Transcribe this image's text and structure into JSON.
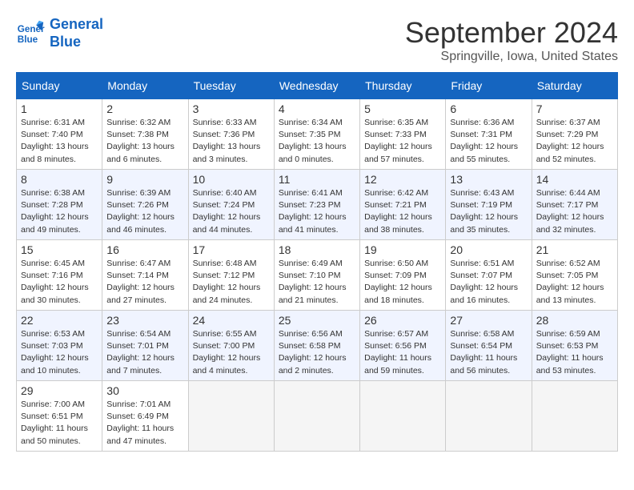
{
  "header": {
    "logo_line1": "General",
    "logo_line2": "Blue",
    "month": "September 2024",
    "location": "Springville, Iowa, United States"
  },
  "weekdays": [
    "Sunday",
    "Monday",
    "Tuesday",
    "Wednesday",
    "Thursday",
    "Friday",
    "Saturday"
  ],
  "weeks": [
    [
      {
        "day": "1",
        "sunrise": "Sunrise: 6:31 AM",
        "sunset": "Sunset: 7:40 PM",
        "daylight": "Daylight: 13 hours and 8 minutes."
      },
      {
        "day": "2",
        "sunrise": "Sunrise: 6:32 AM",
        "sunset": "Sunset: 7:38 PM",
        "daylight": "Daylight: 13 hours and 6 minutes."
      },
      {
        "day": "3",
        "sunrise": "Sunrise: 6:33 AM",
        "sunset": "Sunset: 7:36 PM",
        "daylight": "Daylight: 13 hours and 3 minutes."
      },
      {
        "day": "4",
        "sunrise": "Sunrise: 6:34 AM",
        "sunset": "Sunset: 7:35 PM",
        "daylight": "Daylight: 13 hours and 0 minutes."
      },
      {
        "day": "5",
        "sunrise": "Sunrise: 6:35 AM",
        "sunset": "Sunset: 7:33 PM",
        "daylight": "Daylight: 12 hours and 57 minutes."
      },
      {
        "day": "6",
        "sunrise": "Sunrise: 6:36 AM",
        "sunset": "Sunset: 7:31 PM",
        "daylight": "Daylight: 12 hours and 55 minutes."
      },
      {
        "day": "7",
        "sunrise": "Sunrise: 6:37 AM",
        "sunset": "Sunset: 7:29 PM",
        "daylight": "Daylight: 12 hours and 52 minutes."
      }
    ],
    [
      {
        "day": "8",
        "sunrise": "Sunrise: 6:38 AM",
        "sunset": "Sunset: 7:28 PM",
        "daylight": "Daylight: 12 hours and 49 minutes."
      },
      {
        "day": "9",
        "sunrise": "Sunrise: 6:39 AM",
        "sunset": "Sunset: 7:26 PM",
        "daylight": "Daylight: 12 hours and 46 minutes."
      },
      {
        "day": "10",
        "sunrise": "Sunrise: 6:40 AM",
        "sunset": "Sunset: 7:24 PM",
        "daylight": "Daylight: 12 hours and 44 minutes."
      },
      {
        "day": "11",
        "sunrise": "Sunrise: 6:41 AM",
        "sunset": "Sunset: 7:23 PM",
        "daylight": "Daylight: 12 hours and 41 minutes."
      },
      {
        "day": "12",
        "sunrise": "Sunrise: 6:42 AM",
        "sunset": "Sunset: 7:21 PM",
        "daylight": "Daylight: 12 hours and 38 minutes."
      },
      {
        "day": "13",
        "sunrise": "Sunrise: 6:43 AM",
        "sunset": "Sunset: 7:19 PM",
        "daylight": "Daylight: 12 hours and 35 minutes."
      },
      {
        "day": "14",
        "sunrise": "Sunrise: 6:44 AM",
        "sunset": "Sunset: 7:17 PM",
        "daylight": "Daylight: 12 hours and 32 minutes."
      }
    ],
    [
      {
        "day": "15",
        "sunrise": "Sunrise: 6:45 AM",
        "sunset": "Sunset: 7:16 PM",
        "daylight": "Daylight: 12 hours and 30 minutes."
      },
      {
        "day": "16",
        "sunrise": "Sunrise: 6:47 AM",
        "sunset": "Sunset: 7:14 PM",
        "daylight": "Daylight: 12 hours and 27 minutes."
      },
      {
        "day": "17",
        "sunrise": "Sunrise: 6:48 AM",
        "sunset": "Sunset: 7:12 PM",
        "daylight": "Daylight: 12 hours and 24 minutes."
      },
      {
        "day": "18",
        "sunrise": "Sunrise: 6:49 AM",
        "sunset": "Sunset: 7:10 PM",
        "daylight": "Daylight: 12 hours and 21 minutes."
      },
      {
        "day": "19",
        "sunrise": "Sunrise: 6:50 AM",
        "sunset": "Sunset: 7:09 PM",
        "daylight": "Daylight: 12 hours and 18 minutes."
      },
      {
        "day": "20",
        "sunrise": "Sunrise: 6:51 AM",
        "sunset": "Sunset: 7:07 PM",
        "daylight": "Daylight: 12 hours and 16 minutes."
      },
      {
        "day": "21",
        "sunrise": "Sunrise: 6:52 AM",
        "sunset": "Sunset: 7:05 PM",
        "daylight": "Daylight: 12 hours and 13 minutes."
      }
    ],
    [
      {
        "day": "22",
        "sunrise": "Sunrise: 6:53 AM",
        "sunset": "Sunset: 7:03 PM",
        "daylight": "Daylight: 12 hours and 10 minutes."
      },
      {
        "day": "23",
        "sunrise": "Sunrise: 6:54 AM",
        "sunset": "Sunset: 7:01 PM",
        "daylight": "Daylight: 12 hours and 7 minutes."
      },
      {
        "day": "24",
        "sunrise": "Sunrise: 6:55 AM",
        "sunset": "Sunset: 7:00 PM",
        "daylight": "Daylight: 12 hours and 4 minutes."
      },
      {
        "day": "25",
        "sunrise": "Sunrise: 6:56 AM",
        "sunset": "Sunset: 6:58 PM",
        "daylight": "Daylight: 12 hours and 2 minutes."
      },
      {
        "day": "26",
        "sunrise": "Sunrise: 6:57 AM",
        "sunset": "Sunset: 6:56 PM",
        "daylight": "Daylight: 11 hours and 59 minutes."
      },
      {
        "day": "27",
        "sunrise": "Sunrise: 6:58 AM",
        "sunset": "Sunset: 6:54 PM",
        "daylight": "Daylight: 11 hours and 56 minutes."
      },
      {
        "day": "28",
        "sunrise": "Sunrise: 6:59 AM",
        "sunset": "Sunset: 6:53 PM",
        "daylight": "Daylight: 11 hours and 53 minutes."
      }
    ],
    [
      {
        "day": "29",
        "sunrise": "Sunrise: 7:00 AM",
        "sunset": "Sunset: 6:51 PM",
        "daylight": "Daylight: 11 hours and 50 minutes."
      },
      {
        "day": "30",
        "sunrise": "Sunrise: 7:01 AM",
        "sunset": "Sunset: 6:49 PM",
        "daylight": "Daylight: 11 hours and 47 minutes."
      },
      {
        "day": "",
        "sunrise": "",
        "sunset": "",
        "daylight": ""
      },
      {
        "day": "",
        "sunrise": "",
        "sunset": "",
        "daylight": ""
      },
      {
        "day": "",
        "sunrise": "",
        "sunset": "",
        "daylight": ""
      },
      {
        "day": "",
        "sunrise": "",
        "sunset": "",
        "daylight": ""
      },
      {
        "day": "",
        "sunrise": "",
        "sunset": "",
        "daylight": ""
      }
    ]
  ]
}
